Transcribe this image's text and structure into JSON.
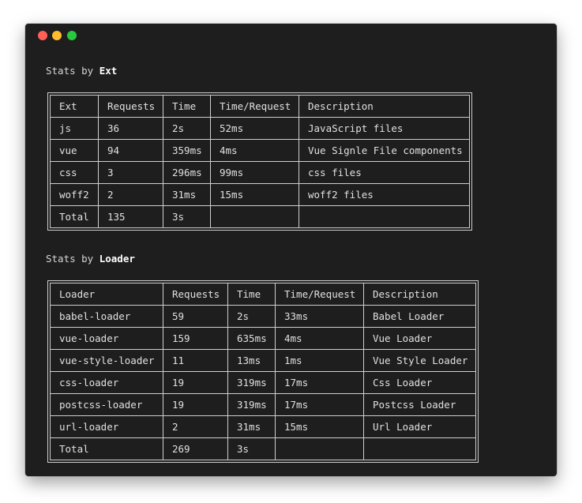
{
  "window": {
    "colors": {
      "background": "#1e1e1e",
      "close": "#ff5f56",
      "minimize": "#ffbd2e",
      "maximize": "#27c93f"
    }
  },
  "ext_section": {
    "title_prefix": "Stats by ",
    "title_emphasis": "Ext",
    "headers": [
      "Ext",
      "Requests",
      "Time",
      "Time/Request",
      "Description"
    ],
    "rows": [
      [
        "js",
        "36",
        "2s",
        "52ms",
        "JavaScript files"
      ],
      [
        "vue",
        "94",
        "359ms",
        "4ms",
        "Vue Signle File components"
      ],
      [
        "css",
        "3",
        "296ms",
        "99ms",
        "css files"
      ],
      [
        "woff2",
        "2",
        "31ms",
        "15ms",
        "woff2 files"
      ],
      [
        "Total",
        "135",
        "3s",
        "",
        ""
      ]
    ]
  },
  "loader_section": {
    "title_prefix": "Stats by ",
    "title_emphasis": "Loader",
    "headers": [
      "Loader",
      "Requests",
      "Time",
      "Time/Request",
      "Description"
    ],
    "rows": [
      [
        "babel-loader",
        "59",
        "2s",
        "33ms",
        "Babel Loader"
      ],
      [
        "vue-loader",
        "159",
        "635ms",
        "4ms",
        "Vue Loader"
      ],
      [
        "vue-style-loader",
        "11",
        "13ms",
        "1ms",
        "Vue Style Loader"
      ],
      [
        "css-loader",
        "19",
        "319ms",
        "17ms",
        "Css Loader"
      ],
      [
        "postcss-loader",
        "19",
        "319ms",
        "17ms",
        "Postcss Loader"
      ],
      [
        "url-loader",
        "2",
        "31ms",
        "15ms",
        "Url Loader"
      ],
      [
        "Total",
        "269",
        "3s",
        "",
        ""
      ]
    ]
  }
}
